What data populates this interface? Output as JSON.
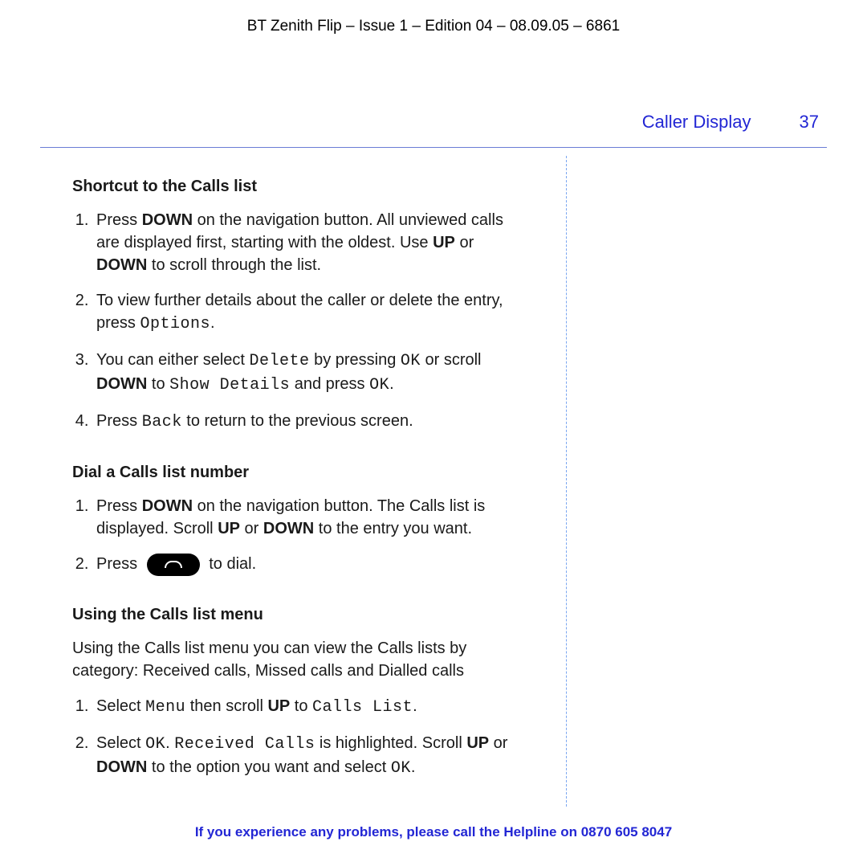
{
  "doc_header": "BT Zenith Flip – Issue 1 – Edition 04 – 08.09.05 – 6861",
  "section": {
    "title": "Caller Display",
    "page_number": "37"
  },
  "blocks": {
    "shortcut": {
      "heading": "Shortcut to the Calls list",
      "items": [
        {
          "pre1": "Press ",
          "b1": "DOWN",
          "post1": " on the navigation button. All unviewed calls are displayed first, starting with the oldest. Use ",
          "b2": "UP",
          "post2": " or ",
          "b3": "DOWN",
          "post3": " to scroll through the list."
        },
        {
          "pre1": "To view further details about the caller or delete the entry, press ",
          "m1": "Options",
          "post1": "."
        },
        {
          "pre1": "You can either select ",
          "m1": "Delete",
          "post1": " by pressing ",
          "m2": "OK",
          "post2": " or scroll ",
          "b1": "DOWN",
          "post3": " to ",
          "m3": "Show Details",
          "post4": " and press ",
          "m4": "OK",
          "post5": "."
        },
        {
          "pre1": "Press ",
          "m1": "Back",
          "post1": " to return to the previous screen."
        }
      ]
    },
    "dial": {
      "heading": "Dial a Calls list number",
      "items": [
        {
          "pre1": "Press ",
          "b1": "DOWN",
          "post1": " on the navigation button. The Calls list is displayed. Scroll ",
          "b2": "UP",
          "post2": " or ",
          "b3": "DOWN",
          "post3": " to the entry you want."
        },
        {
          "pre1": "Press ",
          "post1": " to dial."
        }
      ]
    },
    "menu": {
      "heading": "Using the Calls list menu",
      "intro": "Using the Calls list menu you can view the Calls lists by category: Received calls, Missed calls and Dialled calls",
      "items": [
        {
          "pre1": "Select ",
          "m1": "Menu",
          "post1": " then scroll ",
          "b1": "UP",
          "post2": " to ",
          "m2": "Calls List",
          "post3": "."
        },
        {
          "pre1": "Select ",
          "m1": "OK",
          "post1": ". ",
          "m2": "Received Calls",
          "post2": " is highlighted. Scroll ",
          "b1": "UP",
          "post3": " or ",
          "b2": "DOWN",
          "post4": " to the option you want and select ",
          "m3": "OK",
          "post5": "."
        }
      ]
    }
  },
  "footer": {
    "text": "If you experience any problems, please call the Helpline on ",
    "number": "0870 605 8047"
  }
}
